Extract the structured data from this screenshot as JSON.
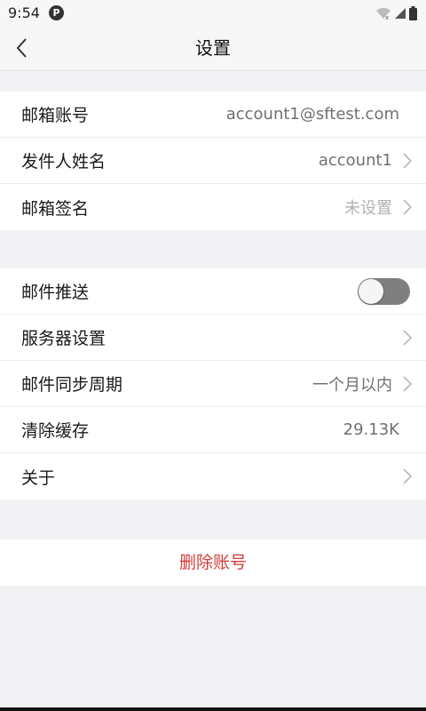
{
  "status": {
    "time": "9:54",
    "app_icon_letter": "P"
  },
  "navbar": {
    "title": "设置"
  },
  "account_group": [
    {
      "label": "邮箱账号",
      "value": "account1@sftest.com",
      "chevron": false
    },
    {
      "label": "发件人姓名",
      "value": "account1",
      "chevron": true
    },
    {
      "label": "邮箱签名",
      "value": "未设置",
      "chevron": true
    }
  ],
  "settings_group": {
    "push": {
      "label": "邮件推送",
      "enabled": false
    },
    "server": {
      "label": "服务器设置"
    },
    "sync": {
      "label": "邮件同步周期",
      "value": "一个月以内"
    },
    "cache": {
      "label": "清除缓存",
      "value": "29.13K"
    },
    "about": {
      "label": "关于"
    }
  },
  "delete_account": {
    "label": "删除账号"
  },
  "colors": {
    "danger": "#d33a3a",
    "toggle_off": "#7f7f7f"
  }
}
